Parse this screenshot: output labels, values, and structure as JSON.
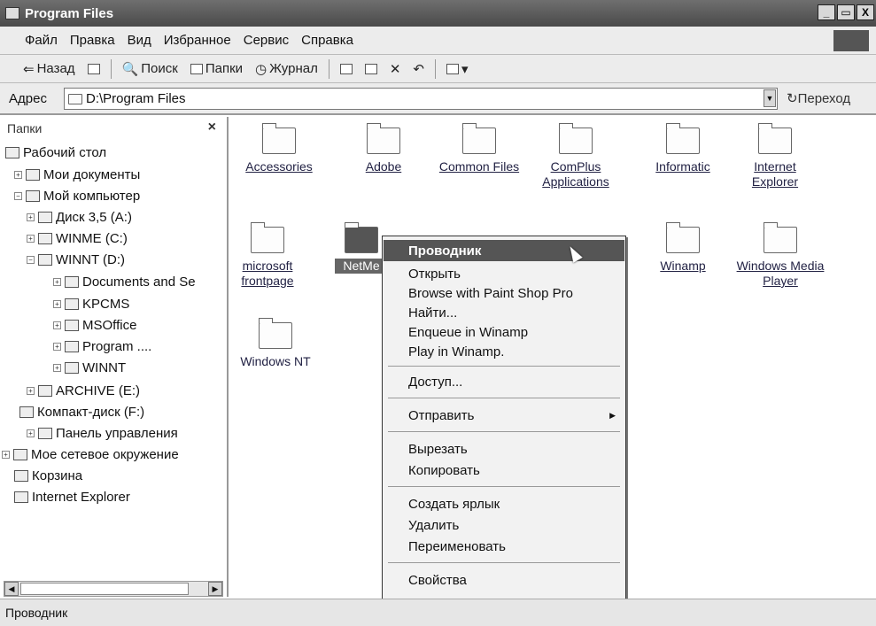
{
  "window": {
    "title": "Program Files",
    "btn_min": "_",
    "btn_max": "▭",
    "btn_close": "X"
  },
  "menubar": {
    "items": [
      "Файл",
      "Правка",
      "Вид",
      "Избранное",
      "Сервис",
      "Справка"
    ]
  },
  "toolbar": {
    "back": "Назад",
    "search": "Поиск",
    "folders": "Папки",
    "history": "Журнал"
  },
  "address": {
    "label": "Адрес",
    "value": "D:\\Program Files",
    "go": "Переход"
  },
  "folders_pane": {
    "title": "Папки",
    "close": "×",
    "tree": [
      "Рабочий стол",
      "Мои документы",
      "Мой компьютер",
      "Диск 3,5 (A:)",
      "WINME (C:)",
      "WINNT (D:)",
      "Documents and Se",
      "KPCMS",
      "MSOffice",
      "Program ....",
      "WINNT",
      "ARCHIVE (E:)",
      "Компакт-диск (F:)",
      "Панель управления",
      "Мое сетевое окружение",
      "Корзина",
      "Internet Explorer"
    ]
  },
  "files": [
    "Accessories",
    "Adobe",
    "Common Files",
    "ComPlus Applications",
    "Informatic",
    "Internet Explorer",
    "microsoft frontpage",
    "NetMe",
    "Winamp",
    "Windows Media Player",
    "Windows NT"
  ],
  "context_menu": {
    "items": [
      "Проводник",
      "Открыть",
      "Browse with Paint Shop Pro",
      "Найти...",
      "Enqueue in Winamp",
      "Play in Winamp.",
      "Доступ...",
      "Отправить",
      "Вырезать",
      "Копировать",
      "Создать ярлык",
      "Удалить",
      "Переименовать",
      "Свойства"
    ]
  },
  "statusbar": {
    "text": "Проводник"
  }
}
